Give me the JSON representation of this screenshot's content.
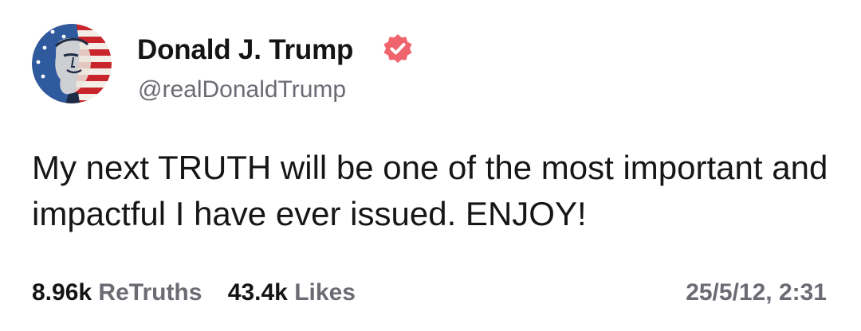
{
  "author": {
    "display_name": "Donald J. Trump",
    "handle": "@realDonaldTrump",
    "verified_badge_color": "#f0646e",
    "avatar_description_icon": "avatar-flag-portrait-icon"
  },
  "post": {
    "text": "My next TRUTH will be one of the most important and impactful I have ever issued. ENJOY!"
  },
  "stats": {
    "retruths_count": "8.96k",
    "retruths_label": "ReTruths",
    "likes_count": "43.4k",
    "likes_label": "Likes"
  },
  "timestamp": "25/5/12, 2:31",
  "colors": {
    "text_primary": "#141414",
    "text_secondary": "#6b6b74",
    "background": "#ffffff"
  }
}
